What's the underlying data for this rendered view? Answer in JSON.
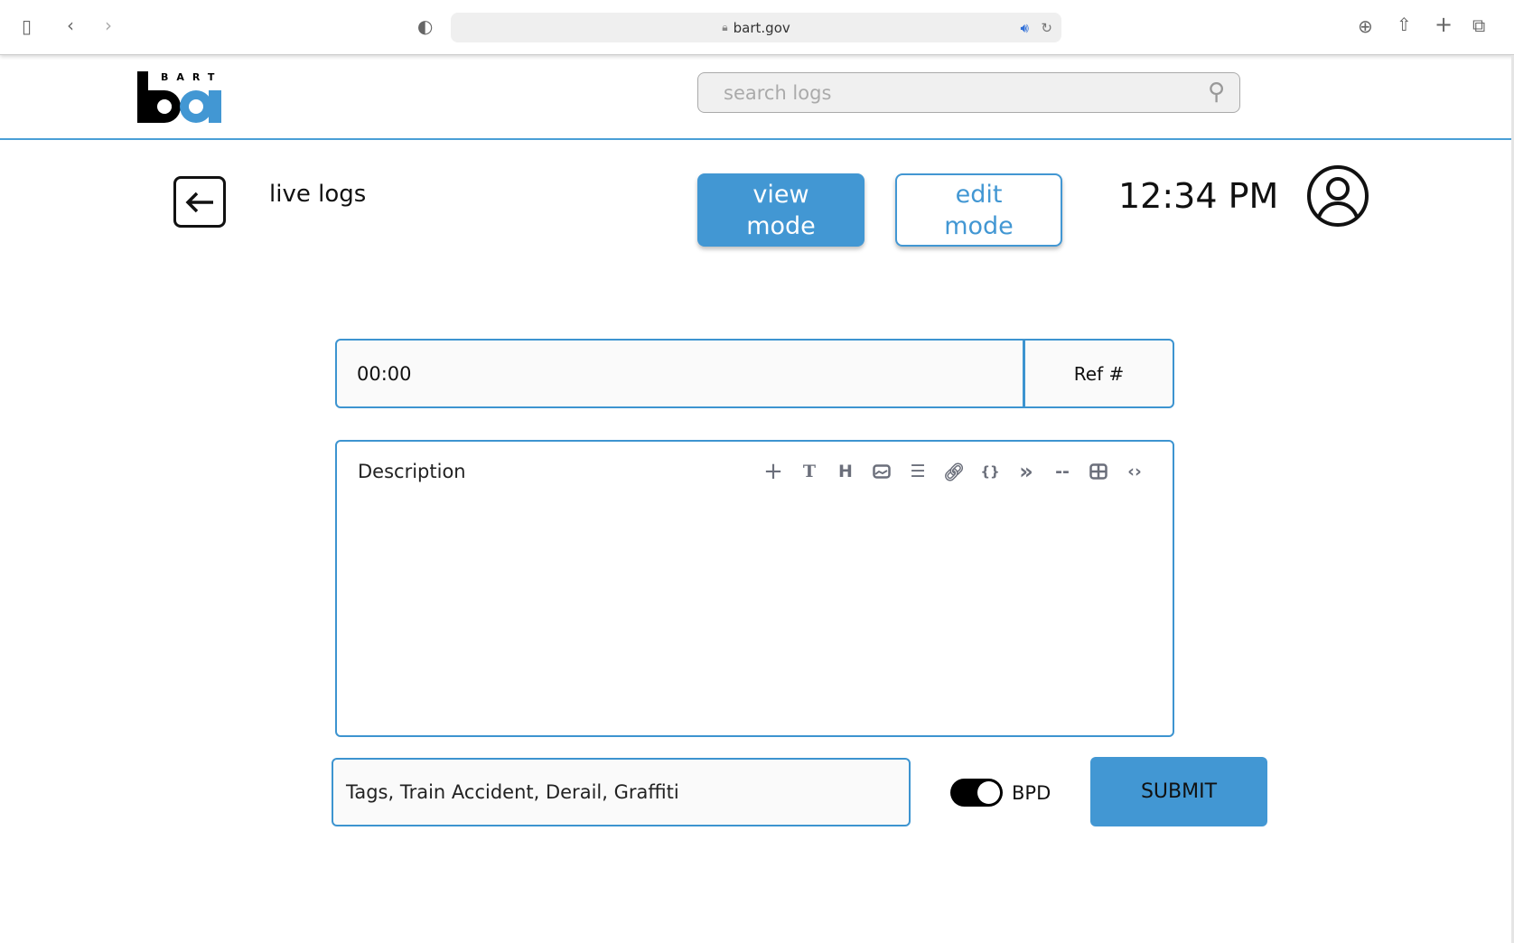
{
  "browser": {
    "url": "bart.gov"
  },
  "header": {
    "logo_text": "BART",
    "search_placeholder": "search logs"
  },
  "toolbar": {
    "title": "live logs",
    "view_mode": "view mode",
    "edit_mode": "edit mode",
    "time": "12:34 PM"
  },
  "form": {
    "time_value": "00:00",
    "ref_placeholder": "Ref #",
    "description_placeholder": "Description",
    "editor_tools": [
      "add",
      "text",
      "heading",
      "image",
      "list",
      "link",
      "code-block",
      "quote",
      "divider",
      "table",
      "code"
    ],
    "tags_value": "Tags, Train Accident, Derail, Graffiti",
    "toggle_label": "BPD",
    "toggle_on": true,
    "submit_label": "SUBMIT"
  },
  "colors": {
    "accent": "#4297d3"
  }
}
